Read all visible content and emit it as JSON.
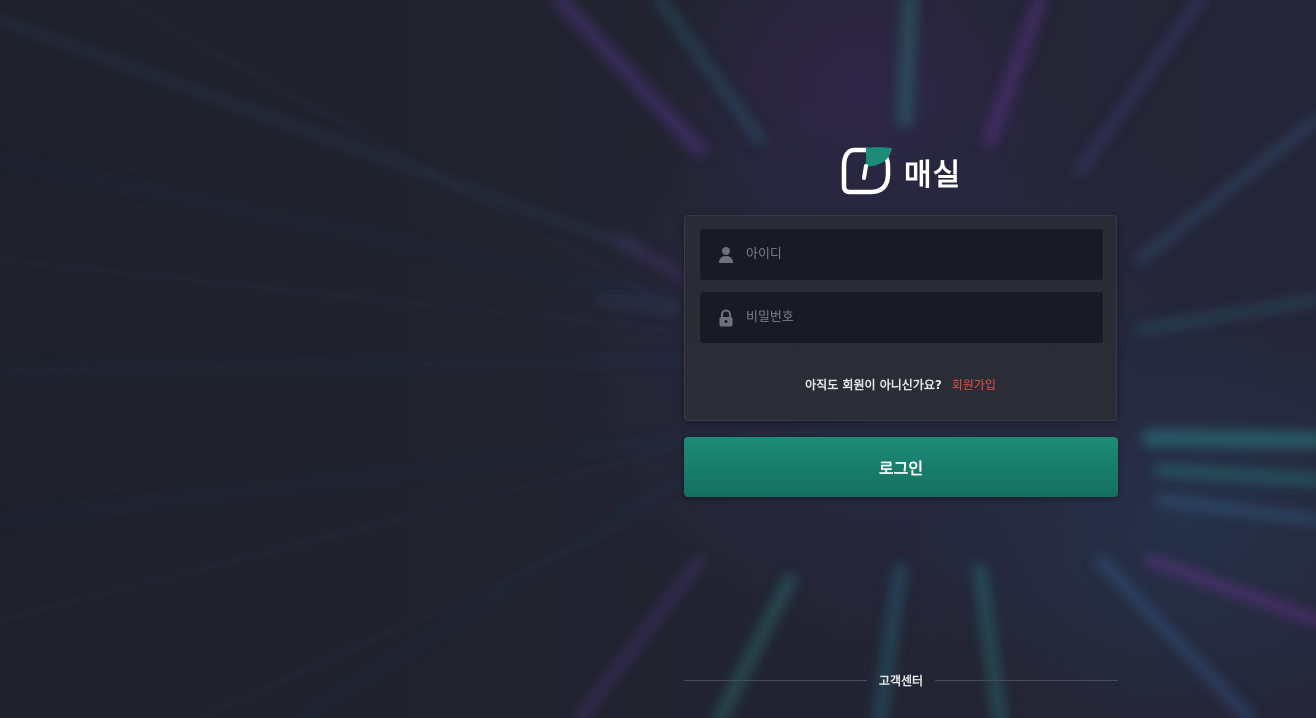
{
  "brand": {
    "name": "매실",
    "logo_icon": "leaf-logo-icon",
    "accent_color": "#1d8b77"
  },
  "login_form": {
    "username": {
      "placeholder": "아이디",
      "value": "",
      "icon": "user-icon"
    },
    "password": {
      "placeholder": "비밀번호",
      "value": "",
      "icon": "lock-icon"
    },
    "signup_prompt": "아직도 회원이 아니신가요?",
    "signup_link": "회원가입",
    "signup_link_color": "#e0524a",
    "submit_label": "로그인"
  },
  "footer": {
    "support_label": "고객센터"
  }
}
